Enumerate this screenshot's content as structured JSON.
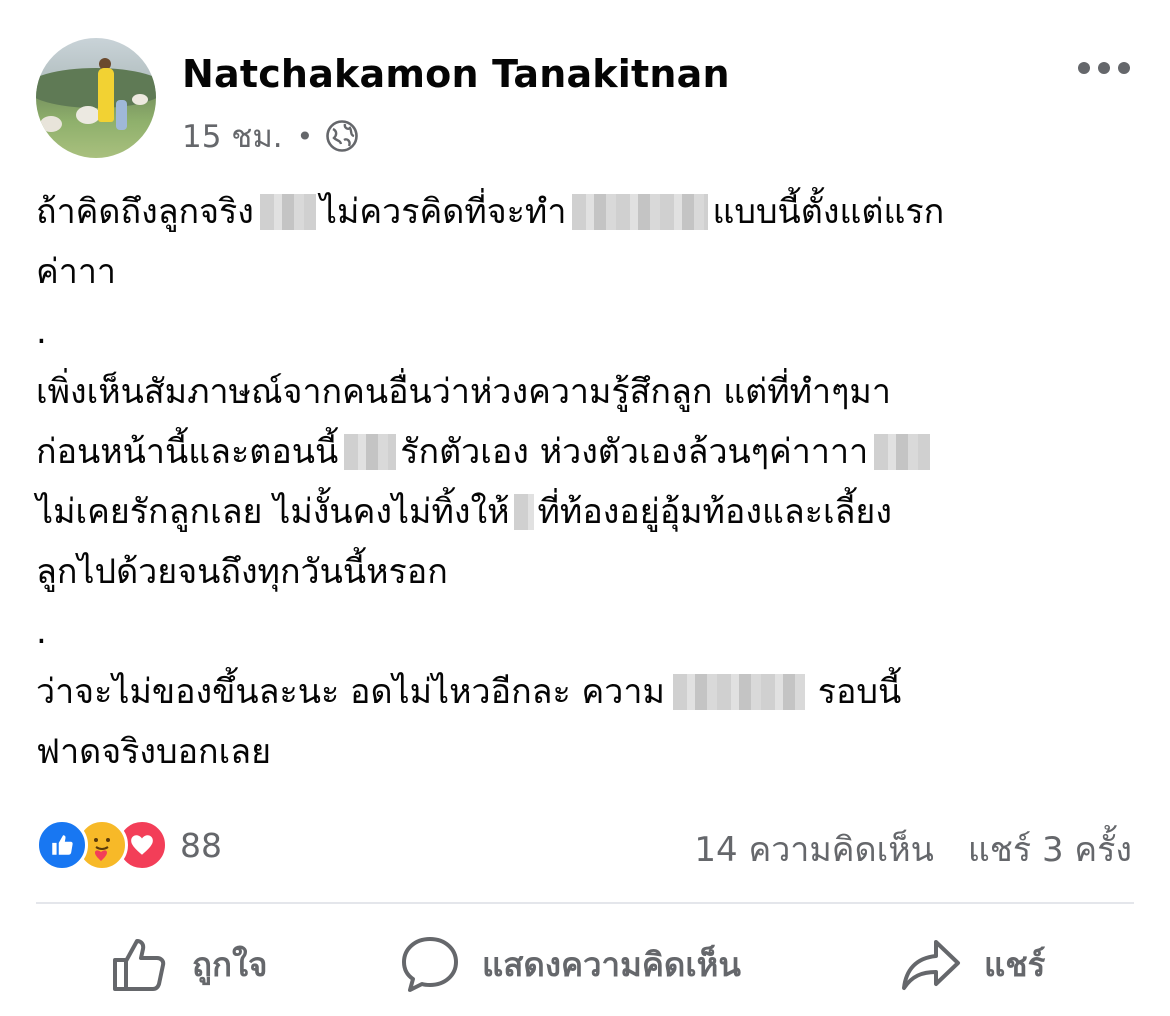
{
  "author": {
    "name": "Natchakamon Tanakitnan"
  },
  "meta": {
    "time": "15 ชม.",
    "separator": "•",
    "privacy_icon": "globe-icon"
  },
  "post": {
    "segments": [
      [
        "ถ้าคิดถึงลูกจริง",
        "ไม่ควรคิดที่จะทำ",
        "แบบนี้ตั้งแต่แรก"
      ],
      [
        "ค่าาา"
      ],
      [
        "."
      ],
      [
        "เพิ่งเห็นสัมภาษณ์จากคนอื่นว่าห่วงความรู้สึกลูก แต่ที่ทำๆมา"
      ],
      [
        "ก่อนหน้านี้และตอนนี้",
        "รักตัวเอง ห่วงตัวเองล้วนๆค่าาาา"
      ],
      [
        "ไม่เคยรักลูกเลย ไม่งั้นคงไม่ทิ้งให้",
        "ที่ท้องอยู่อุ้มท้องและเลี้ยง"
      ],
      [
        "ลูกไปด้วยจนถึงทุกวันนี้หรอก"
      ],
      [
        "."
      ],
      [
        "ว่าจะไม่ของขึ้นละนะ อดไม่ไหวอีกละ ความ",
        " รอบนี้"
      ],
      [
        "ฟาดจริงบอกเลย"
      ]
    ]
  },
  "reactions": {
    "count": "88",
    "types": [
      "like",
      "care",
      "love"
    ]
  },
  "stats": {
    "comments": "14 ความคิดเห็น",
    "shares": "แชร์ 3 ครั้ง"
  },
  "actions": {
    "like": "ถูกใจ",
    "comment": "แสดงความคิดเห็น",
    "share": "แชร์"
  },
  "colors": {
    "accent": "#1877f2",
    "secondary_text": "#65676b",
    "love": "#f33e58",
    "care": "#f7b928"
  }
}
